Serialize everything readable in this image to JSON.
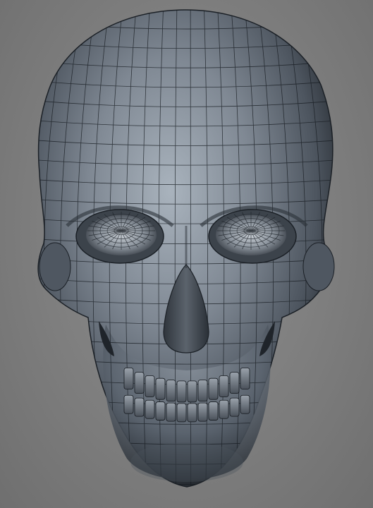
{
  "scene": {
    "subject": "skull-wireframe-render",
    "colors": {
      "background": "#7f7f7f",
      "surface_light": "#a9b3bd",
      "surface_mid": "#5d6671",
      "surface_dark": "#252b32",
      "wire": "#14191e"
    }
  }
}
